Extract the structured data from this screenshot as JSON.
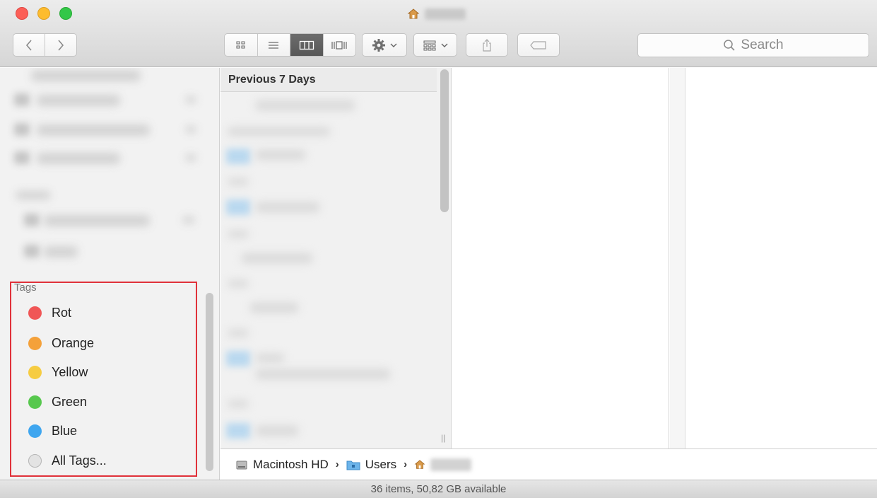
{
  "toolbar": {
    "search_placeholder": "Search"
  },
  "icons": {
    "back": "chevron-left-icon",
    "forward": "chevron-right-icon",
    "icon_view": "grid-icon",
    "list_view": "list-icon",
    "column_view": "columns-icon",
    "cover_flow": "coverflow-icon",
    "action": "gear-icon",
    "arrange": "arrange-icon",
    "share": "share-icon",
    "tag": "tag-icon",
    "search": "search-icon",
    "home": "home-icon"
  },
  "sidebar": {
    "tags_heading": "Tags",
    "tags": [
      {
        "label": "Rot",
        "color": "#f05656"
      },
      {
        "label": "Orange",
        "color": "#f4a13a"
      },
      {
        "label": "Yellow",
        "color": "#f6cc42"
      },
      {
        "label": "Green",
        "color": "#57c84e"
      },
      {
        "label": "Blue",
        "color": "#3fa6ef"
      },
      {
        "label": "All Tags...",
        "color": "#e3e3e3"
      }
    ]
  },
  "column1": {
    "header": "Previous 7 Days"
  },
  "pathbar": {
    "items": [
      {
        "label": "Macintosh HD",
        "icon": "hard-drive-icon"
      },
      {
        "label": "Users",
        "icon": "folder-icon"
      },
      {
        "label": "",
        "icon": "home-icon"
      }
    ]
  },
  "status": {
    "text": "36 items, 50,82 GB available"
  }
}
